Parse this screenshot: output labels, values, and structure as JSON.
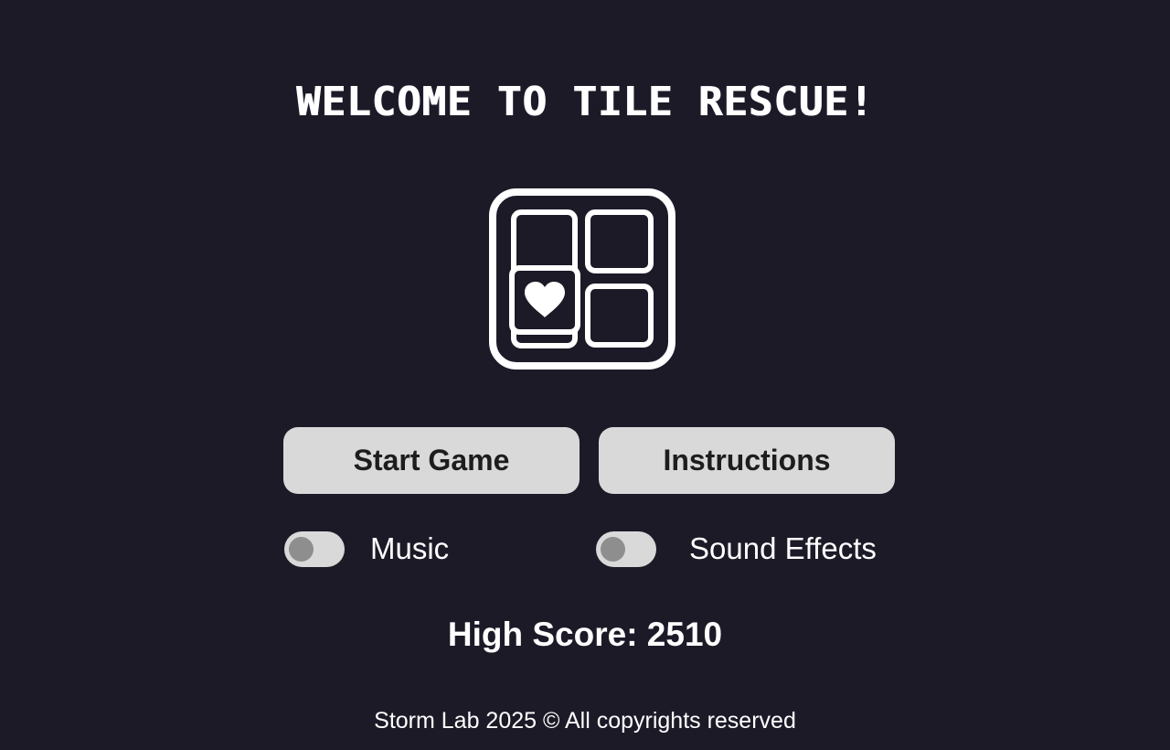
{
  "title": "WELCOME TO TILE RESCUE!",
  "logo": {
    "icon": "tile-grid-heart-icon"
  },
  "buttons": {
    "start": "Start Game",
    "instructions": "Instructions"
  },
  "toggles": {
    "music": {
      "label": "Music",
      "on": false
    },
    "sound_effects": {
      "label": "Sound Effects",
      "on": false
    }
  },
  "high_score": {
    "text": "High Score: 2510",
    "value": 2510
  },
  "footer": "Storm Lab 2025 © All copyrights reserved",
  "colors": {
    "background": "#1d1a28",
    "button": "#d9d9d9",
    "button_text": "#1d1d1d",
    "toggle_knob": "#8e8e8e",
    "text": "#ffffff"
  }
}
